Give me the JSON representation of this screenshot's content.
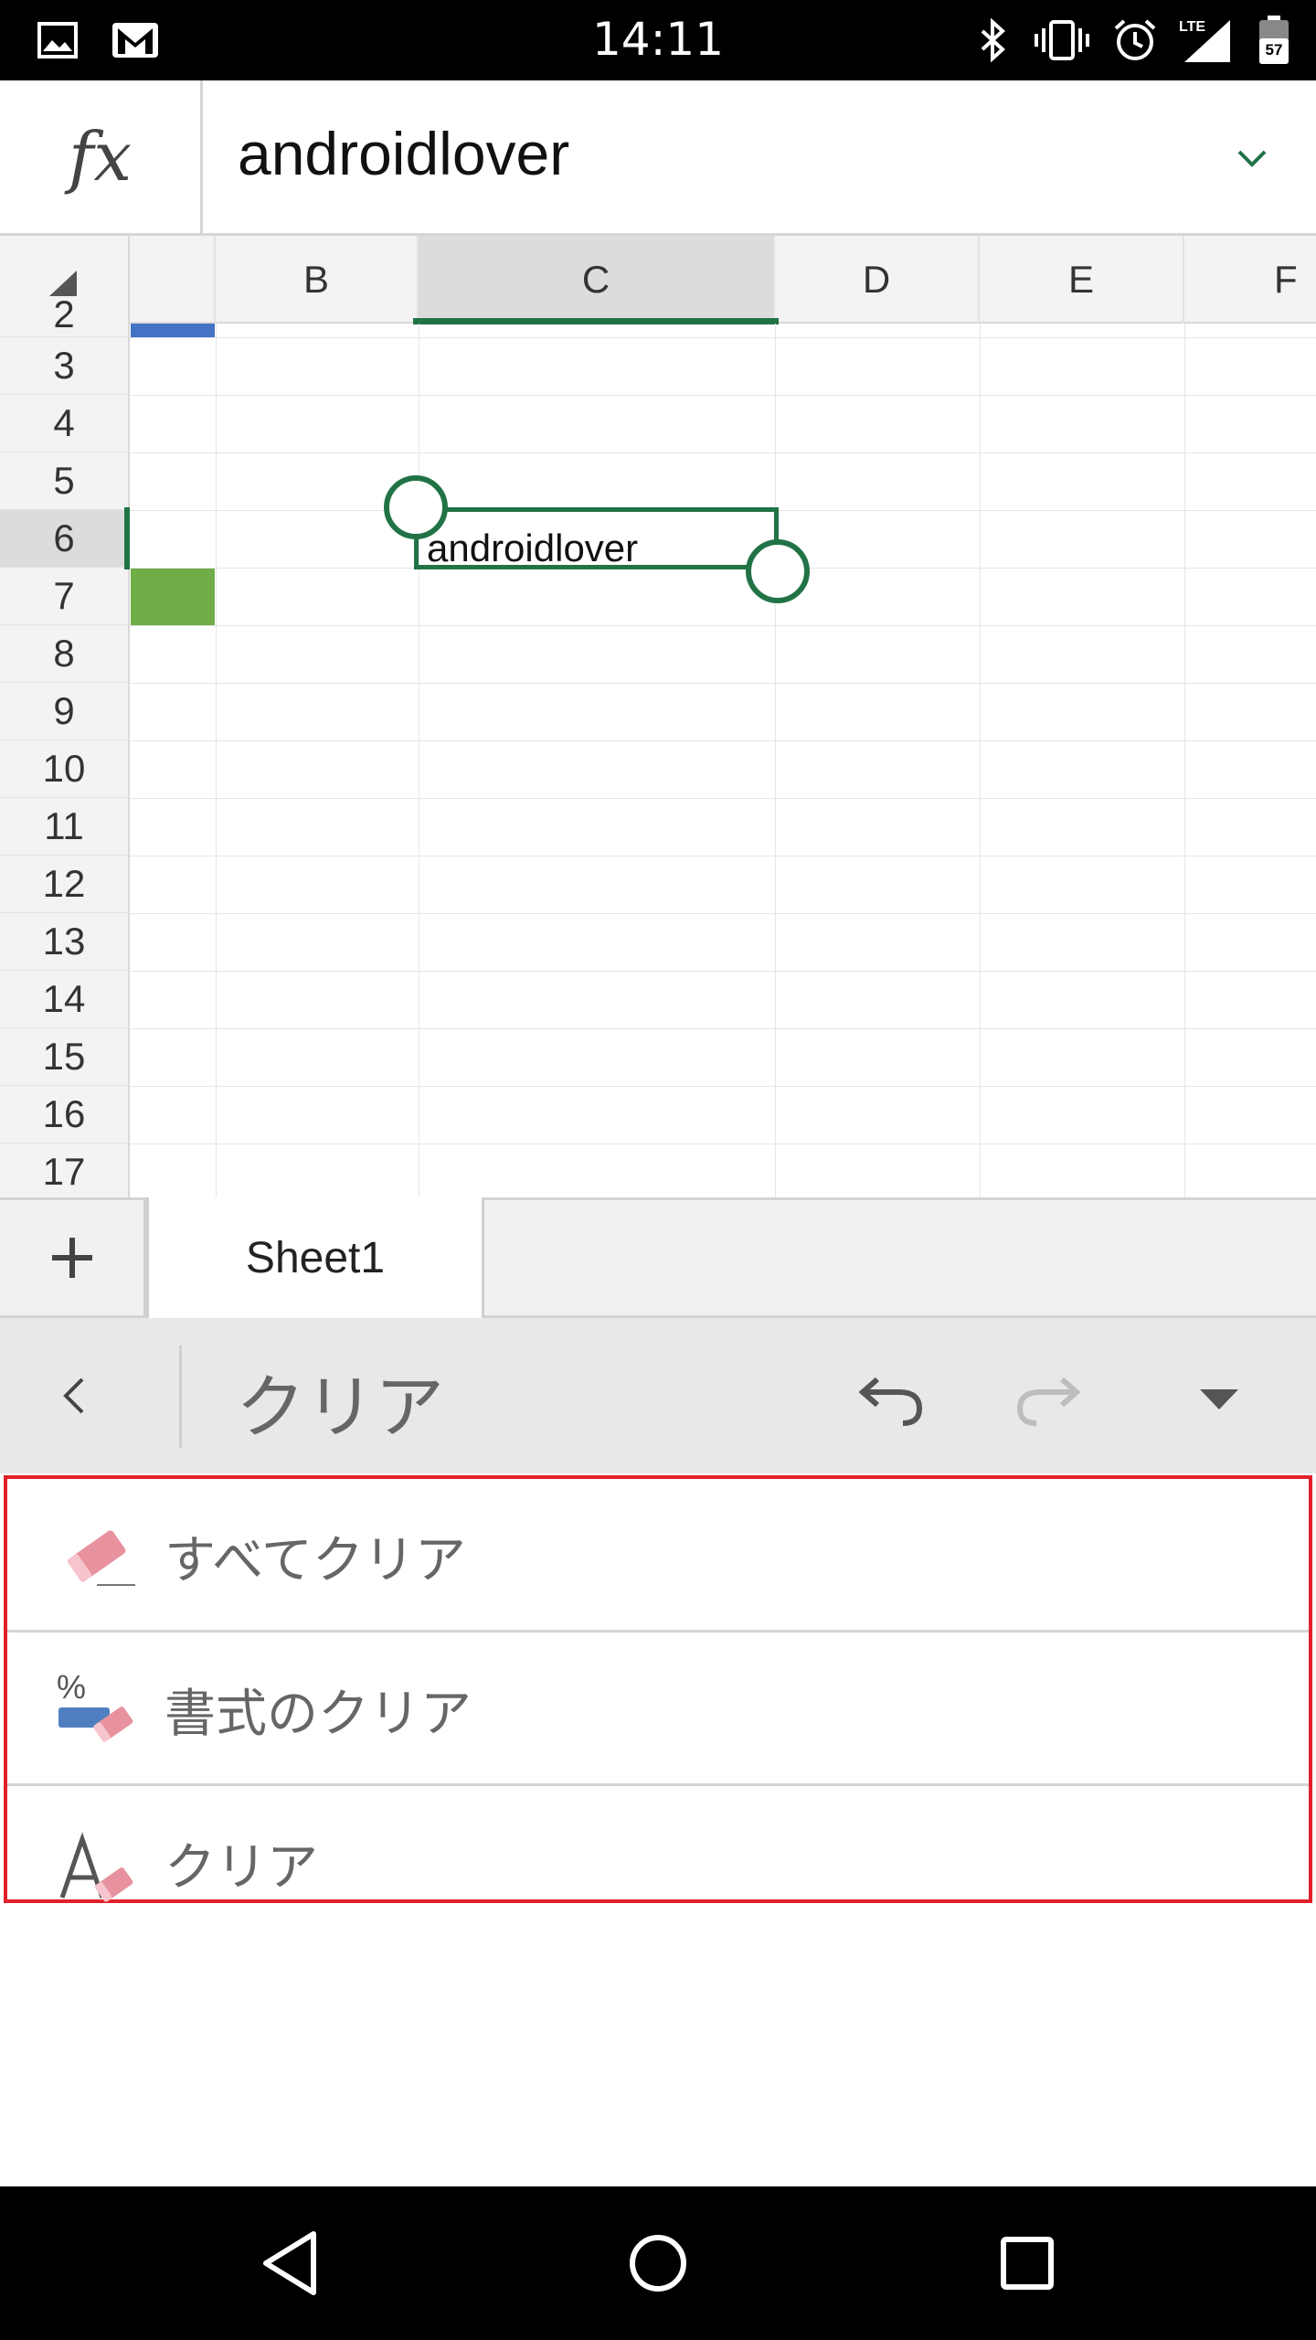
{
  "status_bar": {
    "time": "14:11",
    "network": "LTE",
    "battery": "57",
    "left_icons": [
      "image-icon",
      "gmail-icon"
    ],
    "right_icons": [
      "bluetooth-icon",
      "vibrate-icon",
      "alarm-icon",
      "signal-icon",
      "battery-icon"
    ]
  },
  "formula_bar": {
    "fx_label": "fx",
    "value": "androidlover"
  },
  "grid": {
    "columns": [
      "B",
      "C",
      "D",
      "E",
      "F"
    ],
    "selected_column": "C",
    "rows": [
      "2",
      "3",
      "4",
      "5",
      "6",
      "7",
      "8",
      "9",
      "10",
      "11",
      "12",
      "13",
      "14",
      "15",
      "16",
      "17"
    ],
    "selected_row": "6",
    "active_cell_value": "androidlover",
    "colors": {
      "accent": "#217346",
      "blue_fill": "#4472c4",
      "green_fill": "#70ad47"
    }
  },
  "sheet_tabs": {
    "add_label": "+",
    "tabs": [
      {
        "label": "Sheet1"
      }
    ]
  },
  "ribbon": {
    "title": "クリア"
  },
  "menu": {
    "items": [
      {
        "label": "すべてクリア",
        "icon": "eraser-icon"
      },
      {
        "label": "書式のクリア",
        "icon": "clear-format-icon"
      },
      {
        "label": "クリア",
        "icon": "clear-contents-icon"
      }
    ],
    "highlight_color": "#e0212b"
  },
  "nav_bar": {
    "buttons": [
      "back-icon",
      "home-icon",
      "recents-icon"
    ]
  }
}
